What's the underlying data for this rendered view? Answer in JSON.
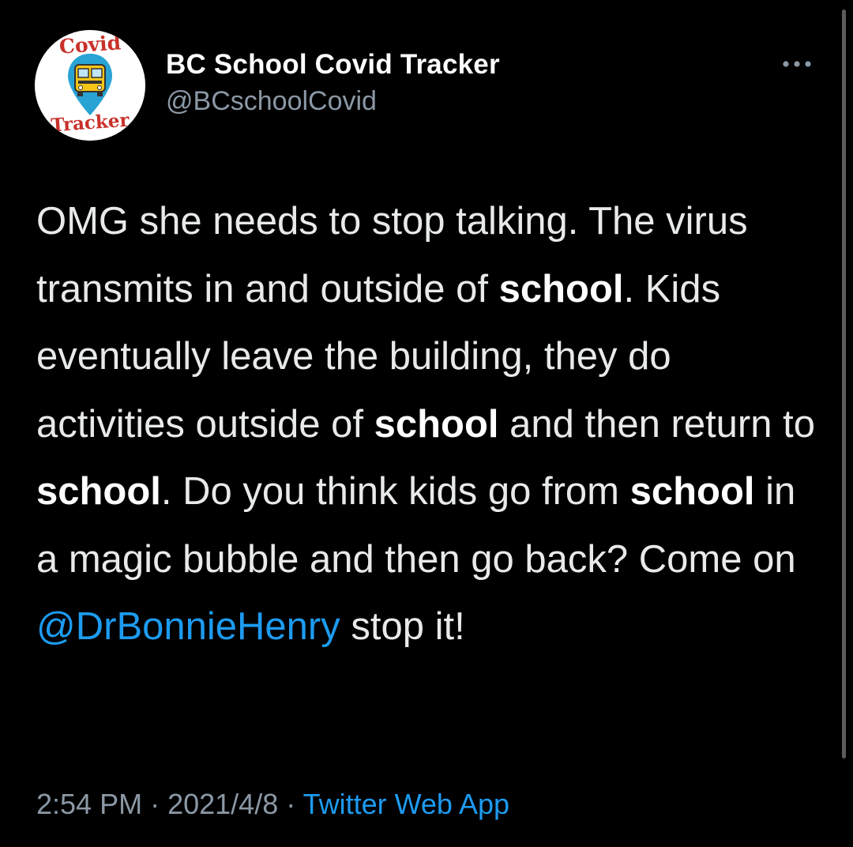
{
  "tweet": {
    "author": {
      "display_name": "BC School Covid Tracker",
      "handle": "@BCschoolCovid",
      "avatar": {
        "text_top": "Covid",
        "text_bottom": "Tracker",
        "icon": "school-bus-icon",
        "colors": {
          "text": "#c8312a",
          "marker": "#29a3d4",
          "bus": "#f5c518"
        }
      }
    },
    "more_icon": "more-options-icon",
    "body": {
      "segments": {
        "s1": "OMG she needs to stop talking.  The virus transmits in and outside of ",
        "s2": "school",
        "s3": ". Kids eventually leave the building, they do activities outside of ",
        "s4": "school",
        "s5": " and then return to ",
        "s6": "school",
        "s7": ". Do you think kids go from ",
        "s8": "school",
        "s9": " in a magic bubble and then go back? Come on ",
        "mention": "@DrBonnieHenry",
        "s10": " stop it!"
      }
    },
    "meta": {
      "time": "2:54 PM",
      "separator": " · ",
      "date": "2021/4/8",
      "source": "Twitter Web App"
    }
  },
  "colors": {
    "background": "#000000",
    "text": "#e7e9ea",
    "secondary": "#8b98a5",
    "link": "#1d9bf0"
  }
}
